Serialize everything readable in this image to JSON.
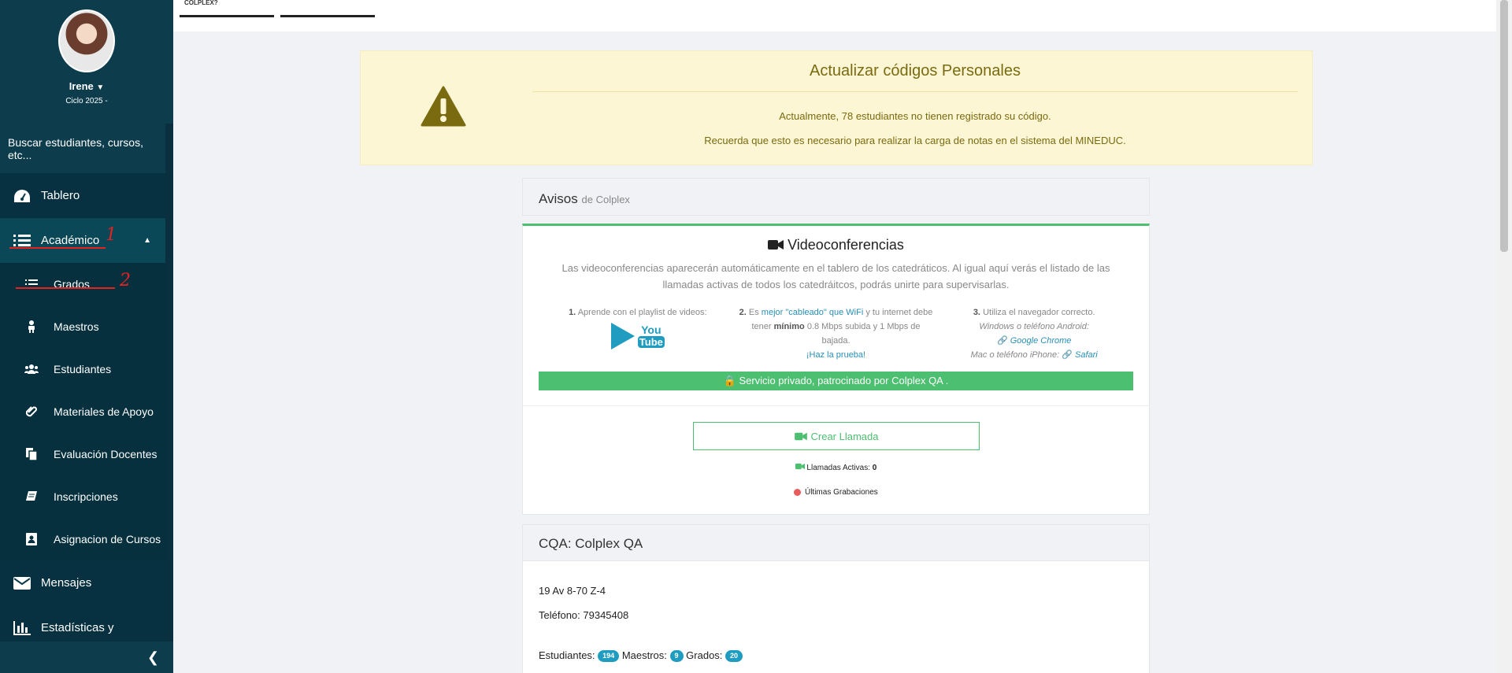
{
  "topbar": {
    "tab1_text": "COLPLEX?"
  },
  "sidebar": {
    "user_name": "Irene",
    "cycle": "Ciclo 2025 -",
    "search_placeholder": "Buscar estudiantes, cursos, etc...",
    "items": [
      {
        "label": "Tablero",
        "icon": "dashboard-icon"
      },
      {
        "label": "Académico",
        "icon": "list-icon"
      },
      {
        "label": "Mensajes",
        "icon": "envelope-icon"
      },
      {
        "label": "Estadísticas y",
        "icon": "bar-chart-icon"
      }
    ],
    "submenu": [
      {
        "label": "Grados",
        "icon": "list-icon"
      },
      {
        "label": "Maestros",
        "icon": "person-icon"
      },
      {
        "label": "Estudiantes",
        "icon": "users-icon"
      },
      {
        "label": "Materiales de Apoyo",
        "icon": "paperclip-icon"
      },
      {
        "label": "Evaluación Docentes",
        "icon": "documents-icon"
      },
      {
        "label": "Inscripciones",
        "icon": "book-icon"
      },
      {
        "label": "Asignacion de Cursos",
        "icon": "id-card-icon"
      }
    ],
    "annotations": [
      "1",
      "2"
    ]
  },
  "alert": {
    "title": "Actualizar códigos Personales",
    "line1": "Actualmente, 78 estudiantes no tienen registrado su código.",
    "line2": "Recuerda que esto es necesario para realizar la carga de notas en el sistema del MINEDUC."
  },
  "avisos": {
    "title": "Avisos",
    "subtitle": "de Colplex"
  },
  "video": {
    "title": "Videoconferencias",
    "description": "Las videoconferencias aparecerán automáticamente en el tablero de los catedráticos. Al igual aquí verás el listado de las llamadas activas de todos los catedráitcos, podrás unirte para supervisarlas.",
    "step1_num": "1.",
    "step1": "Aprende con el playlist de videos:",
    "step2_num": "2.",
    "step2_a": "Es",
    "step2_link": "mejor \"cableado\" que WiFi",
    "step2_b": "y tu internet debe tener",
    "step2_bold": "mínimo",
    "step2_c": "0.8 Mbps subida y 1 Mbps de bajada.",
    "step2_test": "¡Haz la prueba!",
    "step3_num": "3.",
    "step3": "Utiliza el navegador correcto.",
    "step3_android": "Windows o teléfono Android:",
    "step3_chrome": "Google Chrome",
    "step3_mac": "Mac o teléfono iPhone:",
    "step3_safari": "Safari",
    "youtube_you": "You",
    "youtube_tube": "Tube",
    "private_banner": "Servicio privado, patrocinado por Colplex QA .",
    "create_call": "Crear Llamada",
    "active_calls_label": "Llamadas Activas:",
    "active_calls_count": "0",
    "recordings": "Últimas Grabaciones"
  },
  "school": {
    "title": "CQA: Colplex QA",
    "address": "19 Av 8-70 Z-4",
    "phone": "Teléfono: 79345408",
    "students_label": "Estudiantes:",
    "students": "194",
    "teachers_label": "Maestros:",
    "teachers": "9",
    "grades_label": "Grados:",
    "grades": "20"
  },
  "colors": {
    "sidebar": "#0d3d4d",
    "success": "#4cbf70",
    "alert_bg": "#fcf6d4",
    "badge": "#1f9cc0"
  }
}
